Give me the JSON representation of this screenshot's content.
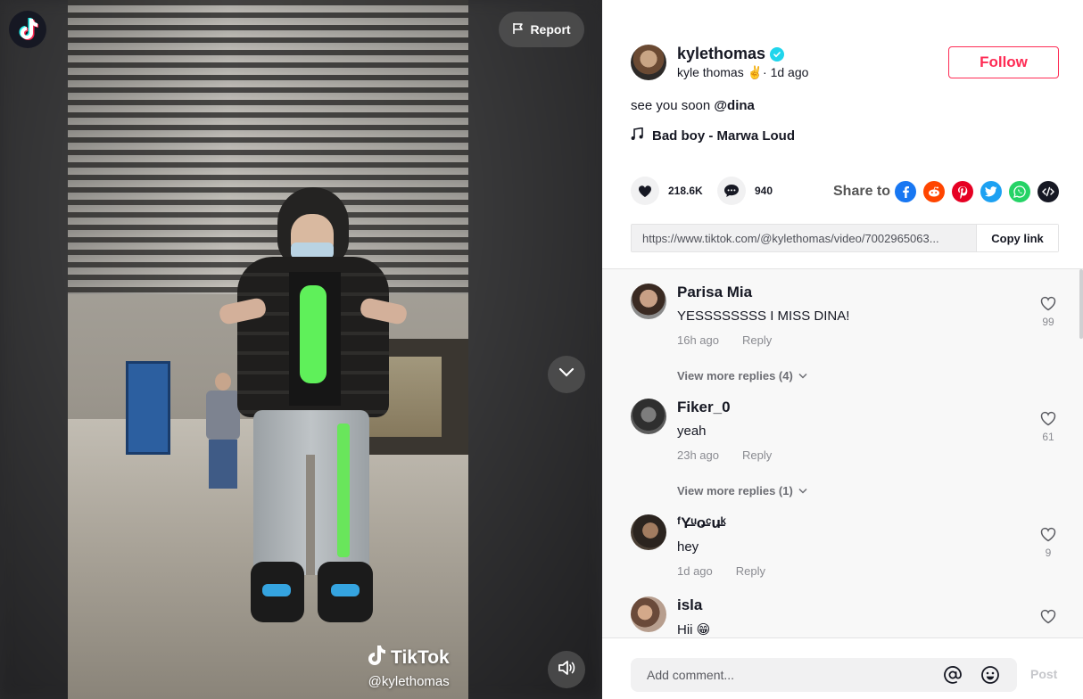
{
  "video": {
    "watermark_brand": "TikTok",
    "watermark_handle": "@kylethomas",
    "report_label": "Report"
  },
  "author": {
    "username": "kylethomas",
    "display_name": "kyle thomas",
    "emoji": "✌️",
    "separator": "·",
    "posted": "1d ago",
    "follow_label": "Follow"
  },
  "caption": {
    "text": "see you soon ",
    "mention": "@dina"
  },
  "music": {
    "title": "Bad boy - Marwa Loud"
  },
  "stats": {
    "likes": "218.6K",
    "comments": "940",
    "share_label": "Share to"
  },
  "share_icons": [
    "facebook-icon",
    "reddit-icon",
    "pinterest-icon",
    "twitter-icon",
    "whatsapp-icon",
    "embed-icon"
  ],
  "colors": {
    "accent": "#fe2c55",
    "verified": "#20d5ec",
    "facebook": "#1877f2",
    "reddit": "#ff4500",
    "pinterest": "#e60023",
    "twitter": "#1da1f2",
    "whatsapp": "#25d366",
    "embed": "#161823"
  },
  "link": {
    "url": "https://www.tiktok.com/@kylethomas/video/7002965063...",
    "copy_label": "Copy link"
  },
  "comments": [
    {
      "name": "Parisa Mia",
      "text": "YESSSSSSSS I MISS DINA!",
      "time": "16h ago",
      "reply": "Reply",
      "likes": "99",
      "view_more": "View more replies (4)"
    },
    {
      "name": "Fiker_0",
      "text": "yeah",
      "time": "23h ago",
      "reply": "Reply",
      "likes": "61",
      "view_more": "View more replies (1)"
    },
    {
      "name": "ᶠY̶ᵘo̶ᶜu̶ᵏ",
      "text": "hey",
      "time": "1d ago",
      "reply": "Reply",
      "likes": "9"
    },
    {
      "name": "isla",
      "text": "Hii 😁",
      "time": "",
      "reply": "",
      "likes": ""
    }
  ],
  "composer": {
    "placeholder": "Add comment...",
    "post_label": "Post"
  }
}
